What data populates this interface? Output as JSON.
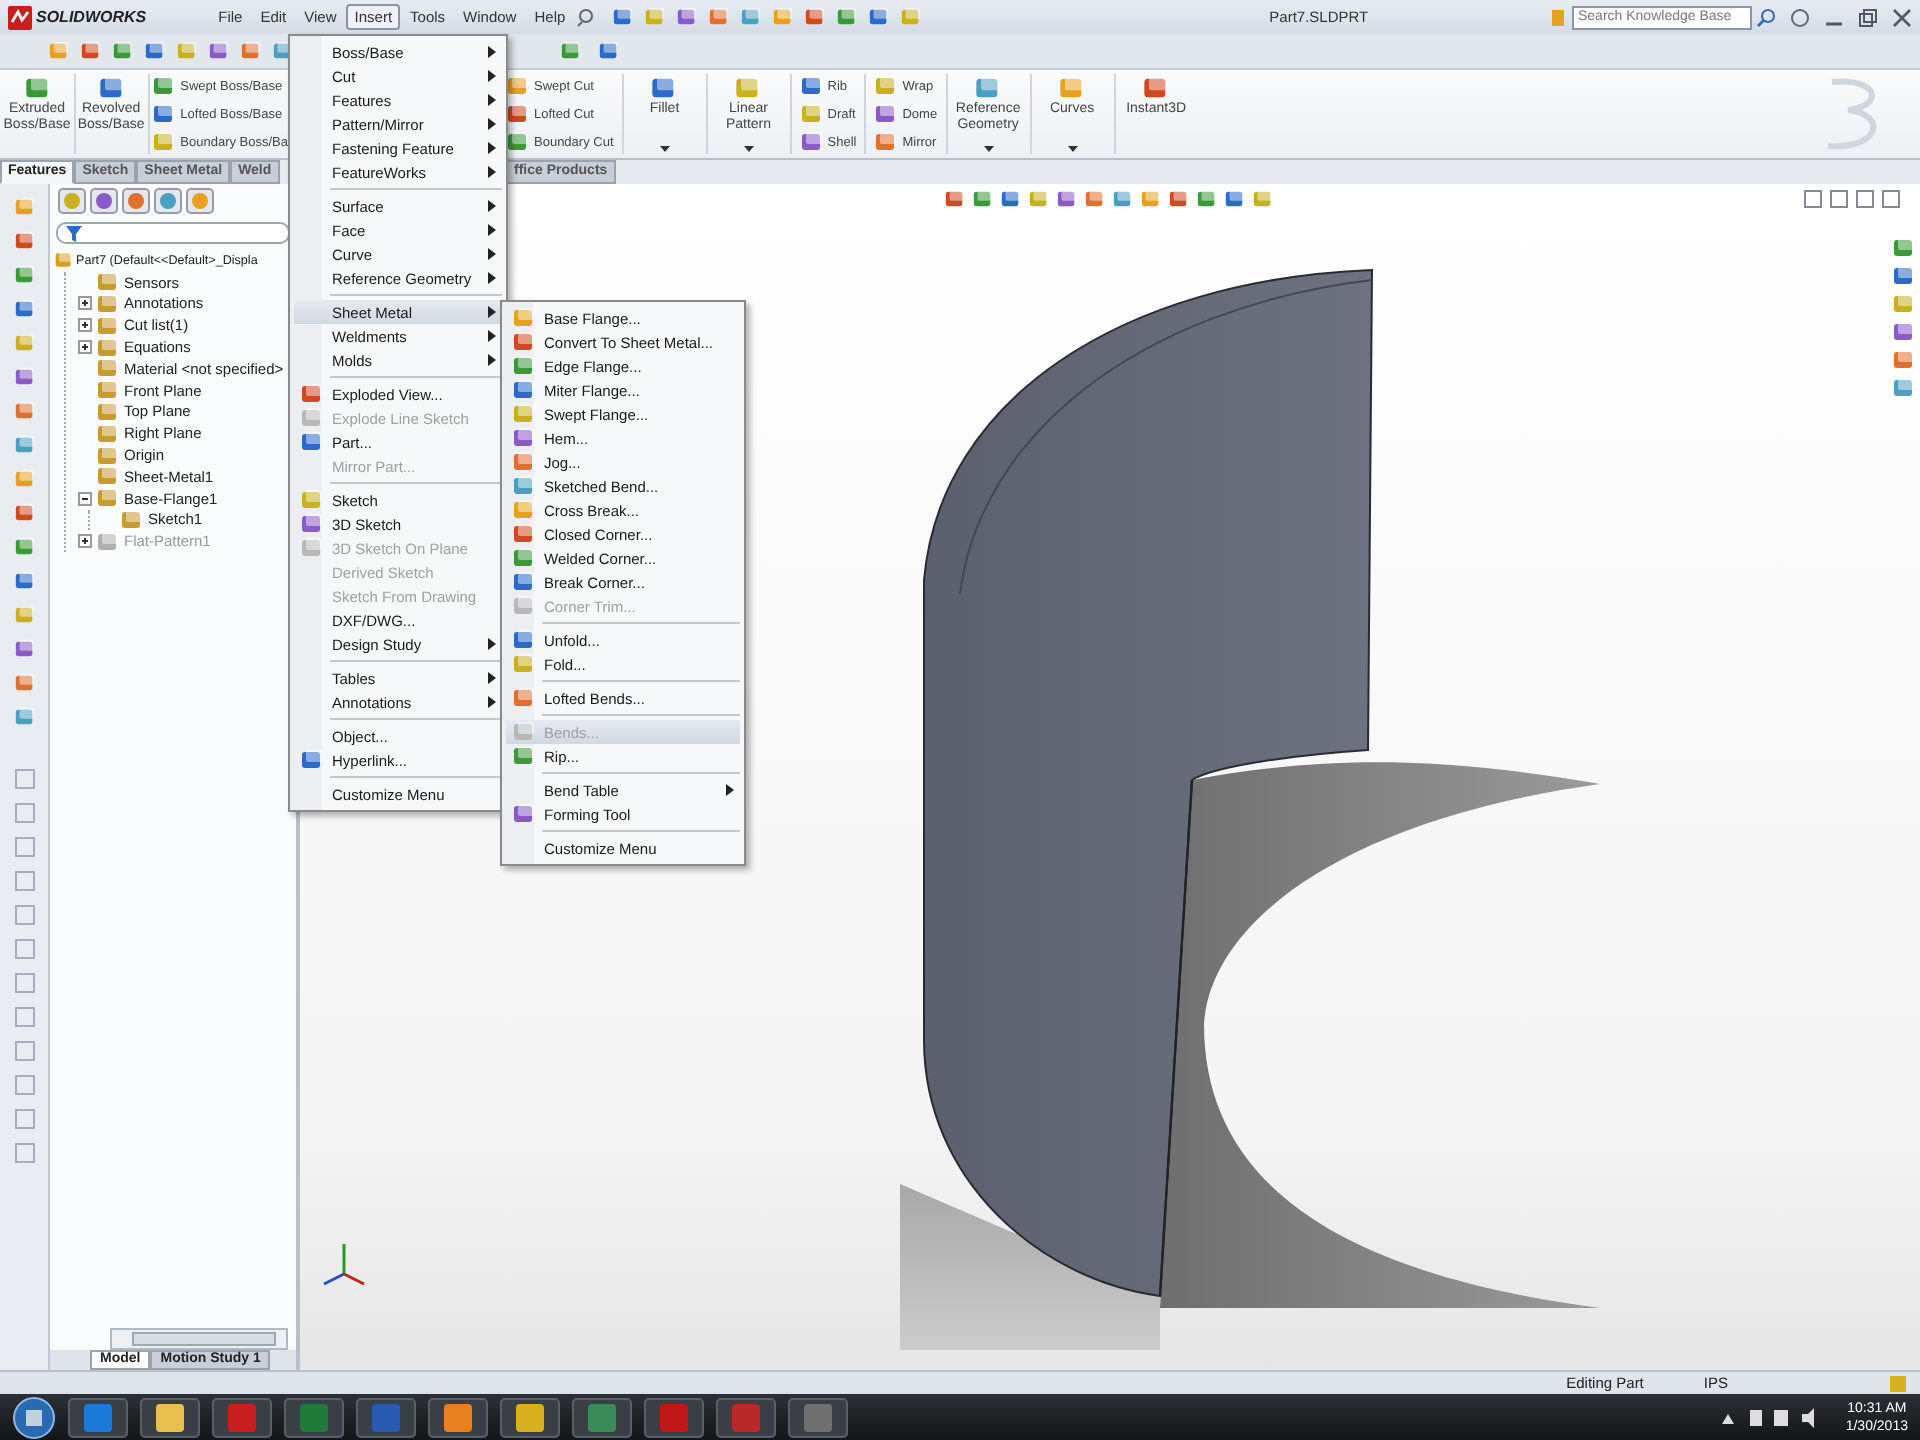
{
  "app": {
    "logo": "SOLIDWORKS",
    "title": "Part7.SLDPRT",
    "search": {
      "placeholder": "Search Knowledge Base"
    }
  },
  "menu_bar": [
    {
      "label": "File",
      "selected": false
    },
    {
      "label": "Edit",
      "selected": false
    },
    {
      "label": "View",
      "selected": false
    },
    {
      "label": "Insert",
      "selected": true
    },
    {
      "label": "Tools",
      "selected": false
    },
    {
      "label": "Window",
      "selected": false
    },
    {
      "label": "Help",
      "selected": false
    }
  ],
  "command_manager": {
    "left": [
      {
        "kind": "large",
        "label": "Extruded Boss/Base",
        "dropdown": false
      },
      {
        "kind": "large",
        "label": "Revolved Boss/Base",
        "dropdown": false
      },
      {
        "kind": "stack",
        "items": [
          "Swept Boss/Base",
          "Lofted Boss/Base",
          "Boundary Boss/Ba"
        ]
      }
    ],
    "right": [
      {
        "kind": "stack",
        "items": [
          "Swept Cut",
          "Lofted Cut",
          "Boundary Cut"
        ]
      },
      {
        "kind": "large",
        "label": "Fillet",
        "dropdown": true
      },
      {
        "kind": "large",
        "label": "Linear Pattern",
        "dropdown": true
      },
      {
        "kind": "stack",
        "items": [
          "Rib",
          "Draft",
          "Shell"
        ]
      },
      {
        "kind": "stack",
        "items": [
          "Wrap",
          "Dome",
          "Mirror"
        ]
      },
      {
        "kind": "large",
        "label": "Reference Geometry",
        "dropdown": true
      },
      {
        "kind": "large",
        "label": "Curves",
        "dropdown": true
      },
      {
        "kind": "large",
        "label": "Instant3D",
        "dropdown": false
      }
    ]
  },
  "tabs": {
    "left": [
      {
        "label": "Features",
        "selected": true
      },
      {
        "label": "Sketch",
        "selected": false
      },
      {
        "label": "Sheet Metal",
        "selected": false
      },
      {
        "label": "Weld",
        "selected": false
      }
    ],
    "right": [
      {
        "label": "ffice Products",
        "selected": false
      }
    ]
  },
  "feature_tree": {
    "label": "Part7  (Default<<Default>_Displa",
    "children": [
      {
        "label": "Sensors",
        "greyed": false
      },
      {
        "label": "Annotations",
        "expanded": false,
        "greyed": false
      },
      {
        "label": "Cut list(1)",
        "expanded": false,
        "greyed": false
      },
      {
        "label": "Equations",
        "expanded": false,
        "greyed": false
      },
      {
        "label": "Material <not specified>",
        "greyed": false
      },
      {
        "label": "Front Plane",
        "greyed": false
      },
      {
        "label": "Top Plane",
        "greyed": false
      },
      {
        "label": "Right Plane",
        "greyed": false
      },
      {
        "label": "Origin",
        "greyed": false
      },
      {
        "label": "Sheet-Metal1",
        "greyed": false
      },
      {
        "label": "Base-Flange1",
        "expanded": true,
        "greyed": false,
        "children": [
          {
            "label": "Sketch1",
            "greyed": false
          }
        ]
      },
      {
        "label": "Flat-Pattern1",
        "expanded": false,
        "greyed": true
      }
    ]
  },
  "insert_menu": {
    "groups": [
      [
        {
          "label": "Boss/Base",
          "submenu": true,
          "disabled": false,
          "selected": false,
          "has_icon": false
        },
        {
          "label": "Cut",
          "submenu": true,
          "disabled": false,
          "selected": false,
          "has_icon": false
        },
        {
          "label": "Features",
          "submenu": true,
          "disabled": false,
          "selected": false,
          "has_icon": false
        },
        {
          "label": "Pattern/Mirror",
          "submenu": true,
          "disabled": false,
          "selected": false,
          "has_icon": false
        },
        {
          "label": "Fastening Feature",
          "submenu": true,
          "disabled": false,
          "selected": false,
          "has_icon": false
        },
        {
          "label": "FeatureWorks",
          "submenu": true,
          "disabled": false,
          "selected": false,
          "has_icon": false
        }
      ],
      [
        {
          "label": "Surface",
          "submenu": true,
          "disabled": false,
          "selected": false,
          "has_icon": false
        },
        {
          "label": "Face",
          "submenu": true,
          "disabled": false,
          "selected": false,
          "has_icon": false
        },
        {
          "label": "Curve",
          "submenu": true,
          "disabled": false,
          "selected": false,
          "has_icon": false
        },
        {
          "label": "Reference Geometry",
          "submenu": true,
          "disabled": false,
          "selected": false,
          "has_icon": false
        }
      ],
      [
        {
          "label": "Sheet Metal",
          "submenu": true,
          "disabled": false,
          "selected": true,
          "has_icon": false
        },
        {
          "label": "Weldments",
          "submenu": true,
          "disabled": false,
          "selected": false,
          "has_icon": false
        },
        {
          "label": "Molds",
          "submenu": true,
          "disabled": false,
          "selected": false,
          "has_icon": false
        }
      ],
      [
        {
          "label": "Exploded View...",
          "submenu": false,
          "disabled": false,
          "selected": false,
          "has_icon": true
        },
        {
          "label": "Explode Line Sketch",
          "submenu": false,
          "disabled": true,
          "selected": false,
          "has_icon": true
        },
        {
          "label": "Part...",
          "submenu": false,
          "disabled": false,
          "selected": false,
          "has_icon": true
        },
        {
          "label": "Mirror Part...",
          "submenu": false,
          "disabled": true,
          "selected": false,
          "has_icon": false
        }
      ],
      [
        {
          "label": "Sketch",
          "submenu": false,
          "disabled": false,
          "selected": false,
          "has_icon": true
        },
        {
          "label": "3D Sketch",
          "submenu": false,
          "disabled": false,
          "selected": false,
          "has_icon": true
        },
        {
          "label": "3D Sketch On Plane",
          "submenu": false,
          "disabled": true,
          "selected": false,
          "has_icon": true
        },
        {
          "label": "Derived Sketch",
          "submenu": false,
          "disabled": true,
          "selected": false,
          "has_icon": false
        },
        {
          "label": "Sketch From Drawing",
          "submenu": false,
          "disabled": true,
          "selected": false,
          "has_icon": false
        },
        {
          "label": "DXF/DWG...",
          "submenu": false,
          "disabled": false,
          "selected": false,
          "has_icon": false
        },
        {
          "label": "Design Study",
          "submenu": true,
          "disabled": false,
          "selected": false,
          "has_icon": false
        }
      ],
      [
        {
          "label": "Tables",
          "submenu": true,
          "disabled": false,
          "selected": false,
          "has_icon": false
        },
        {
          "label": "Annotations",
          "submenu": true,
          "disabled": false,
          "selected": false,
          "has_icon": false
        }
      ],
      [
        {
          "label": "Object...",
          "submenu": false,
          "disabled": false,
          "selected": false,
          "has_icon": false
        },
        {
          "label": "Hyperlink...",
          "submenu": false,
          "disabled": false,
          "selected": false,
          "has_icon": true
        }
      ],
      [
        {
          "label": "Customize Menu",
          "submenu": false,
          "disabled": false,
          "selected": false,
          "has_icon": false
        }
      ]
    ]
  },
  "sheet_metal_menu": {
    "groups": [
      [
        {
          "label": "Base Flange...",
          "submenu": false,
          "disabled": false,
          "selected": false,
          "has_icon": true
        },
        {
          "label": "Convert To Sheet Metal...",
          "submenu": false,
          "disabled": false,
          "selected": false,
          "has_icon": true
        },
        {
          "label": "Edge Flange...",
          "submenu": false,
          "disabled": false,
          "selected": false,
          "has_icon": true
        },
        {
          "label": "Miter Flange...",
          "submenu": false,
          "disabled": false,
          "selected": false,
          "has_icon": true
        },
        {
          "label": "Swept Flange...",
          "submenu": false,
          "disabled": false,
          "selected": false,
          "has_icon": true
        },
        {
          "label": "Hem...",
          "submenu": false,
          "disabled": false,
          "selected": false,
          "has_icon": true
        },
        {
          "label": "Jog...",
          "submenu": false,
          "disabled": false,
          "selected": false,
          "has_icon": true
        },
        {
          "label": "Sketched Bend...",
          "submenu": false,
          "disabled": false,
          "selected": false,
          "has_icon": true
        },
        {
          "label": "Cross Break...",
          "submenu": false,
          "disabled": false,
          "selected": false,
          "has_icon": true
        },
        {
          "label": "Closed Corner...",
          "submenu": false,
          "disabled": false,
          "selected": false,
          "has_icon": true
        },
        {
          "label": "Welded Corner...",
          "submenu": false,
          "disabled": false,
          "selected": false,
          "has_icon": true
        },
        {
          "label": "Break Corner...",
          "submenu": false,
          "disabled": false,
          "selected": false,
          "has_icon": true
        },
        {
          "label": "Corner Trim...",
          "submenu": false,
          "disabled": true,
          "selected": false,
          "has_icon": true
        }
      ],
      [
        {
          "label": "Unfold...",
          "submenu": false,
          "disabled": false,
          "selected": false,
          "has_icon": true
        },
        {
          "label": "Fold...",
          "submenu": false,
          "disabled": false,
          "selected": false,
          "has_icon": true
        }
      ],
      [
        {
          "label": "Lofted Bends...",
          "submenu": false,
          "disabled": false,
          "selected": false,
          "has_icon": true
        }
      ],
      [
        {
          "label": "Bends...",
          "submenu": false,
          "disabled": true,
          "selected": true,
          "has_icon": true
        },
        {
          "label": "Rip...",
          "submenu": false,
          "disabled": false,
          "selected": false,
          "has_icon": true
        }
      ],
      [
        {
          "label": "Bend Table",
          "submenu": true,
          "disabled": false,
          "selected": false,
          "has_icon": false
        },
        {
          "label": "Forming Tool",
          "submenu": false,
          "disabled": false,
          "selected": false,
          "has_icon": true
        }
      ],
      [
        {
          "label": "Customize Menu",
          "submenu": false,
          "disabled": false,
          "selected": false,
          "has_icon": false
        }
      ]
    ]
  },
  "model_tabs": [
    {
      "label": "Model",
      "selected": true
    },
    {
      "label": "Motion Study 1",
      "selected": false
    }
  ],
  "status_bar": {
    "status": "Editing Part",
    "units": "IPS"
  },
  "taskbar": {
    "time": "10:31 AM",
    "date": "1/30/2013"
  }
}
